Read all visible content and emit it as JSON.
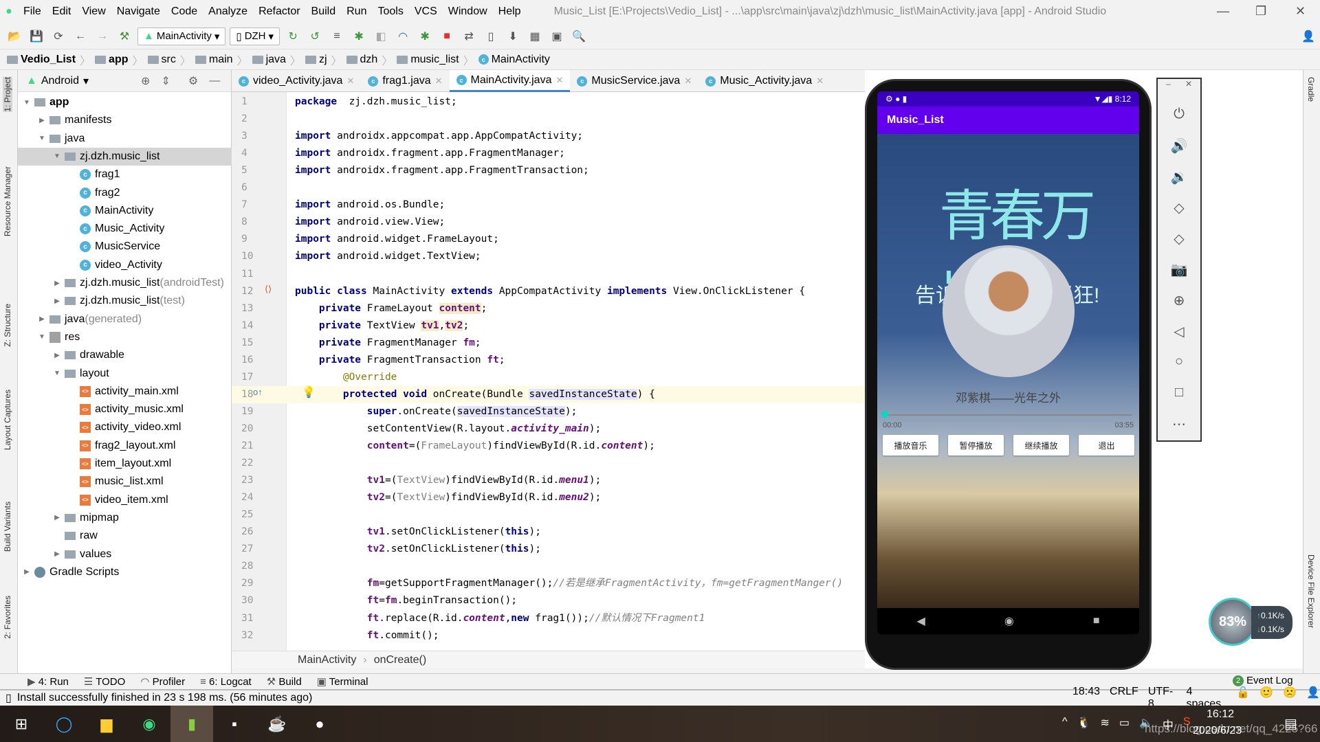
{
  "menubar": {
    "items": [
      "File",
      "Edit",
      "View",
      "Navigate",
      "Code",
      "Analyze",
      "Refactor",
      "Build",
      "Run",
      "Tools",
      "VCS",
      "Window",
      "Help"
    ],
    "title": "Music_List [E:\\Projects\\Vedio_List] - ...\\app\\src\\main\\java\\zj\\dzh\\music_list\\MainActivity.java [app] - Android Studio"
  },
  "toolbar": {
    "run_config": "MainActivity",
    "device": "DZH"
  },
  "breadcrumb": [
    "Vedio_List",
    "app",
    "src",
    "main",
    "java",
    "zj",
    "dzh",
    "music_list",
    "MainActivity"
  ],
  "left_stripe": [
    "1: Project",
    "Resource Manager",
    "Z: Structure",
    "Layout Captures",
    "Build Variants",
    "2: Favorites"
  ],
  "right_stripe": [
    "Gradle",
    "Device File Explorer"
  ],
  "project": {
    "view": "Android",
    "tree": [
      {
        "label": "app",
        "depth": 0,
        "type": "folder",
        "open": true,
        "bold": true
      },
      {
        "label": "manifests",
        "depth": 1,
        "type": "folder",
        "open": false
      },
      {
        "label": "java",
        "depth": 1,
        "type": "folder",
        "open": true
      },
      {
        "label": "zj.dzh.music_list",
        "depth": 2,
        "type": "folder",
        "open": true,
        "selected": true
      },
      {
        "label": "frag1",
        "depth": 3,
        "type": "java"
      },
      {
        "label": "frag2",
        "depth": 3,
        "type": "java"
      },
      {
        "label": "MainActivity",
        "depth": 3,
        "type": "java"
      },
      {
        "label": "Music_Activity",
        "depth": 3,
        "type": "java"
      },
      {
        "label": "MusicService",
        "depth": 3,
        "type": "java"
      },
      {
        "label": "video_Activity",
        "depth": 3,
        "type": "java"
      },
      {
        "label": "zj.dzh.music_list",
        "suffix": " (androidTest)",
        "depth": 2,
        "type": "folder",
        "open": false
      },
      {
        "label": "zj.dzh.music_list",
        "suffix": " (test)",
        "depth": 2,
        "type": "folder",
        "open": false
      },
      {
        "label": "java",
        "suffix": " (generated)",
        "depth": 1,
        "type": "folder",
        "open": false
      },
      {
        "label": "res",
        "depth": 1,
        "type": "res",
        "open": true
      },
      {
        "label": "drawable",
        "depth": 2,
        "type": "folder",
        "open": false
      },
      {
        "label": "layout",
        "depth": 2,
        "type": "folder",
        "open": true
      },
      {
        "label": "activity_main.xml",
        "depth": 3,
        "type": "xml"
      },
      {
        "label": "activity_music.xml",
        "depth": 3,
        "type": "xml"
      },
      {
        "label": "activity_video.xml",
        "depth": 3,
        "type": "xml"
      },
      {
        "label": "frag2_layout.xml",
        "depth": 3,
        "type": "xml"
      },
      {
        "label": "item_layout.xml",
        "depth": 3,
        "type": "xml"
      },
      {
        "label": "music_list.xml",
        "depth": 3,
        "type": "xml"
      },
      {
        "label": "video_item.xml",
        "depth": 3,
        "type": "xml"
      },
      {
        "label": "mipmap",
        "depth": 2,
        "type": "folder",
        "open": false
      },
      {
        "label": "raw",
        "depth": 2,
        "type": "folder"
      },
      {
        "label": "values",
        "depth": 2,
        "type": "folder",
        "open": false
      },
      {
        "label": "Gradle Scripts",
        "depth": 0,
        "type": "gradle",
        "open": false
      }
    ]
  },
  "tabs": [
    {
      "label": "video_Activity.java"
    },
    {
      "label": "frag1.java"
    },
    {
      "label": "MainActivity.java",
      "active": true
    },
    {
      "label": "MusicService.java"
    },
    {
      "label": "Music_Activity.java"
    }
  ],
  "editor": {
    "current_line": 18,
    "lines": [
      [
        [
          "kw",
          "package"
        ],
        [
          "",
          "  zj.dzh.music_list;"
        ]
      ],
      [],
      [
        [
          "kw",
          "import"
        ],
        [
          "",
          " androidx.appcompat.app.AppCompatActivity;"
        ]
      ],
      [
        [
          "kw",
          "import"
        ],
        [
          "",
          " androidx.fragment.app.FragmentManager;"
        ]
      ],
      [
        [
          "kw",
          "import"
        ],
        [
          "",
          " androidx.fragment.app.FragmentTransaction;"
        ]
      ],
      [],
      [
        [
          "kw",
          "import"
        ],
        [
          "",
          " android.os.Bundle;"
        ]
      ],
      [
        [
          "kw",
          "import"
        ],
        [
          "",
          " android.view.View;"
        ]
      ],
      [
        [
          "kw",
          "import"
        ],
        [
          "",
          " android.widget.FrameLayout;"
        ]
      ],
      [
        [
          "kw",
          "import"
        ],
        [
          "",
          " android.widget.TextView;"
        ]
      ],
      [],
      [
        [
          "kw",
          "public class"
        ],
        [
          "",
          " MainActivity "
        ],
        [
          "kw",
          "extends"
        ],
        [
          "",
          " AppCompatActivity "
        ],
        [
          "kw",
          "implements"
        ],
        [
          "",
          " View.OnClickListener {"
        ]
      ],
      [
        [
          "",
          "    "
        ],
        [
          "kw",
          "private"
        ],
        [
          "",
          " FrameLayout "
        ],
        [
          "fld hl",
          "content"
        ],
        [
          "",
          ";"
        ]
      ],
      [
        [
          "",
          "    "
        ],
        [
          "kw",
          "private"
        ],
        [
          "",
          " TextView "
        ],
        [
          "fld hl",
          "tv1"
        ],
        [
          "",
          ","
        ],
        [
          "fld hl",
          "tv2"
        ],
        [
          "",
          ";"
        ]
      ],
      [
        [
          "",
          "    "
        ],
        [
          "kw",
          "private"
        ],
        [
          "",
          " FragmentManager "
        ],
        [
          "fld",
          "fm"
        ],
        [
          "",
          ";"
        ]
      ],
      [
        [
          "",
          "    "
        ],
        [
          "kw",
          "private"
        ],
        [
          "",
          " FragmentTransaction "
        ],
        [
          "fld",
          "ft"
        ],
        [
          "",
          ";"
        ]
      ],
      [
        [
          "ann",
          "        @Override"
        ]
      ],
      [
        [
          "",
          "        "
        ],
        [
          "kw",
          "protected void"
        ],
        [
          "",
          " onCreate(Bundle "
        ],
        [
          "hl2",
          "savedInstanceState"
        ],
        [
          "",
          ") {"
        ]
      ],
      [
        [
          "",
          "            "
        ],
        [
          "kw",
          "super"
        ],
        [
          "",
          ".onCreate("
        ],
        [
          "hl2",
          "savedInstanceState"
        ],
        [
          "",
          ");"
        ]
      ],
      [
        [
          "",
          "            setContentView(R.layout."
        ],
        [
          "ifld",
          "activity_main"
        ],
        [
          "",
          ");"
        ]
      ],
      [
        [
          "",
          "            "
        ],
        [
          "fld",
          "content"
        ],
        [
          "",
          "=("
        ],
        [
          "cast",
          "FrameLayout"
        ],
        [
          "",
          ")findViewById(R.id."
        ],
        [
          "ifld",
          "content"
        ],
        [
          "",
          ");"
        ]
      ],
      [],
      [
        [
          "",
          "            "
        ],
        [
          "fld",
          "tv1"
        ],
        [
          "",
          "=("
        ],
        [
          "cast",
          "TextView"
        ],
        [
          "",
          ")findViewById(R.id."
        ],
        [
          "ifld",
          "menu1"
        ],
        [
          "",
          ");"
        ]
      ],
      [
        [
          "",
          "            "
        ],
        [
          "fld",
          "tv2"
        ],
        [
          "",
          "=("
        ],
        [
          "cast",
          "TextView"
        ],
        [
          "",
          ")findViewById(R.id."
        ],
        [
          "ifld",
          "menu2"
        ],
        [
          "",
          ");"
        ]
      ],
      [],
      [
        [
          "",
          "            "
        ],
        [
          "fld",
          "tv1"
        ],
        [
          "",
          ".setOnClickListener("
        ],
        [
          "kw",
          "this"
        ],
        [
          "",
          ");"
        ]
      ],
      [
        [
          "",
          "            "
        ],
        [
          "fld",
          "tv2"
        ],
        [
          "",
          ".setOnClickListener("
        ],
        [
          "kw",
          "this"
        ],
        [
          "",
          ");"
        ]
      ],
      [],
      [
        [
          "",
          "            "
        ],
        [
          "fld",
          "fm"
        ],
        [
          "",
          "=getSupportFragmentManager();"
        ],
        [
          "cmt",
          "//若是继承FragmentActivity，fm=getFragmentManger()"
        ]
      ],
      [
        [
          "",
          "            "
        ],
        [
          "fld",
          "ft"
        ],
        [
          "",
          "="
        ],
        [
          "fld",
          "fm"
        ],
        [
          "",
          ".beginTransaction();"
        ]
      ],
      [
        [
          "",
          "            "
        ],
        [
          "fld",
          "ft"
        ],
        [
          "",
          ".replace(R.id."
        ],
        [
          "ifld",
          "content"
        ],
        [
          "",
          ","
        ],
        [
          "kw",
          "new"
        ],
        [
          "",
          " frag1());"
        ],
        [
          "cmt",
          "//默认情况下Fragment1"
        ]
      ],
      [
        [
          "",
          "            "
        ],
        [
          "fld",
          "ft"
        ],
        [
          "",
          ".commit();"
        ]
      ]
    ]
  },
  "editor_breadcrumb": [
    "MainActivity",
    "onCreate()"
  ],
  "phone": {
    "status_time": "8:12",
    "app_title": "Music_List",
    "cover_title": "青春万岁",
    "cover_sub_left": "告诉",
    "cover_sub_right": "轻狂!",
    "song_title": "邓紫棋——光年之外",
    "time_current": "00:00",
    "time_total": "03:55",
    "progress": 0,
    "buttons": [
      "播放音乐",
      "暂停播放",
      "继续播放",
      "退出"
    ]
  },
  "tool_windows": [
    "4: Run",
    "TODO",
    "Profiler",
    "6: Logcat",
    "Build",
    "Terminal"
  ],
  "event_log": {
    "count": "2",
    "label": "Event Log"
  },
  "status": {
    "message": "Install successfully finished in 23 s 198 ms. (56 minutes ago)",
    "position": "18:43",
    "line_sep": "CRLF",
    "encoding": "UTF-8",
    "indent": "4 spaces"
  },
  "net_widget": {
    "percent": "83%",
    "up": "0.1K/s",
    "down": "0.1K/s"
  },
  "taskbar": {
    "time": "16:12",
    "date": "2020/6/23",
    "watermark": "https://blog.csdn.net/qq_4225?66"
  }
}
